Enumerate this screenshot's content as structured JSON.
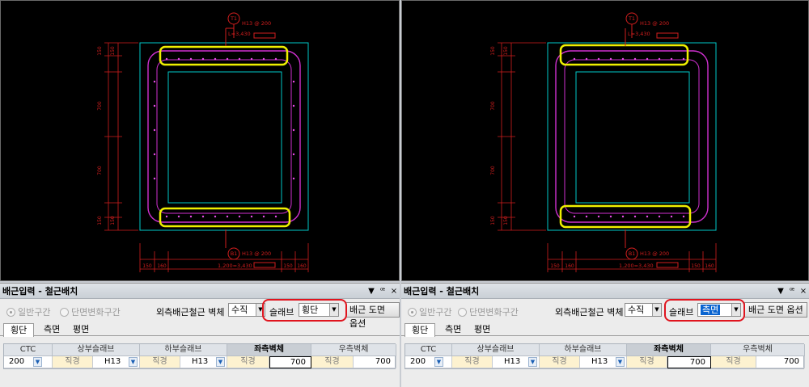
{
  "cad": {
    "top_label": "T1",
    "top_note": "H13 @ 200",
    "top_dim": "L=3,430",
    "bottom_label": "B1",
    "bottom_note": "H13 @ 200",
    "bottom_dim": "1,200=3,430",
    "left_dims": [
      "150",
      "150",
      "700",
      "700",
      "150",
      "150"
    ],
    "bottom_dims": [
      "150",
      "160",
      "150",
      "160"
    ]
  },
  "panels": [
    {
      "title": "배근입력 - 철근배치",
      "title_buttons": [
        "▼",
        "ꟹ",
        "×"
      ],
      "radio_general": "일반구간",
      "radio_section": "단면변화구간",
      "outer_bar_label": "외측배근철근 벽체",
      "outer_bar_value": "수직",
      "slab_label": "슬래브",
      "slab_value": "횡단",
      "slab_selected": false,
      "option_button": "배근 도면 옵션",
      "tabs": [
        "횡단",
        "측면",
        "평면"
      ],
      "grid_headers": [
        "CTC",
        "상부슬래브",
        "하부슬래브",
        "좌측벽체",
        "우측벽체"
      ],
      "grid_row": {
        "ctc": "200",
        "top_dia_label": "직경",
        "top_dia": "H13",
        "bot_dia_label": "직경",
        "bot_dia": "H13",
        "left_dia_label": "직경",
        "left_val": "700",
        "right_dia_label": "직경",
        "right_val": "700"
      }
    },
    {
      "title": "배근입력 - 철근배치",
      "title_buttons": [
        "▼",
        "ꟹ",
        "×"
      ],
      "radio_general": "일반구간",
      "radio_section": "단면변화구간",
      "outer_bar_label": "외측배근철근 벽체",
      "outer_bar_value": "수직",
      "slab_label": "슬래브",
      "slab_value": "측면",
      "slab_selected": true,
      "option_button": "배근 도면 옵션",
      "tabs": [
        "횡단",
        "측면",
        "평면"
      ],
      "grid_headers": [
        "CTC",
        "상부슬래브",
        "하부슬래브",
        "좌측벽체",
        "우측벽체"
      ],
      "grid_row": {
        "ctc": "200",
        "top_dia_label": "직경",
        "top_dia": "H13",
        "bot_dia_label": "직경",
        "bot_dia": "H13",
        "left_dia_label": "직경",
        "left_val": "700",
        "right_dia_label": "직경",
        "right_val": "700"
      }
    }
  ],
  "colors": {
    "cad_bg": "#000000",
    "outline": "#00c8c8",
    "rebar": "#d030d0",
    "dims": "#d21e1e",
    "highlight_yellow": "#f0f000",
    "highlight_red": "#e0141e"
  }
}
